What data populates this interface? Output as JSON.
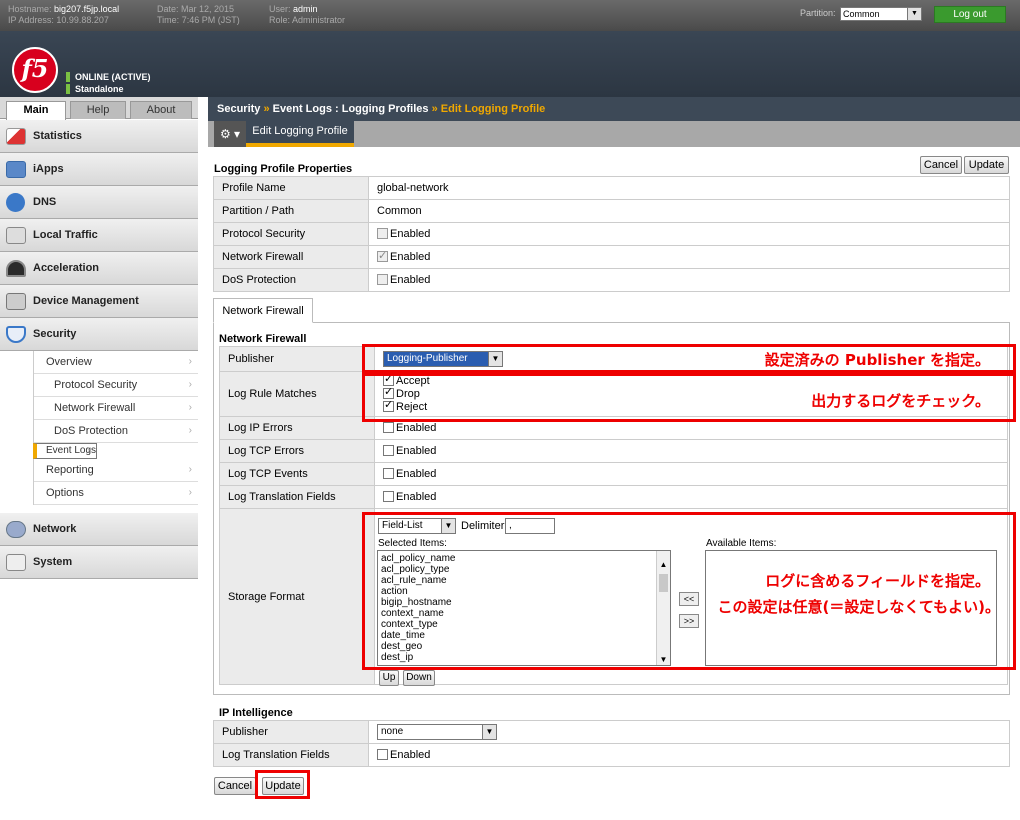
{
  "topbar": {
    "hostname_label": "Hostname:",
    "hostname": "big207.f5jp.local",
    "ip_label": "IP Address:",
    "ip": "10.99.88.207",
    "date_label": "Date:",
    "date": "Mar 12, 2015",
    "time_label": "Time:",
    "time": "7:46 PM (JST)",
    "user_label": "User:",
    "user": "admin",
    "role_label": "Role:",
    "role": "Administrator",
    "partition_label": "Partition:",
    "partition_value": "Common",
    "logout": "Log out"
  },
  "header": {
    "status1": "ONLINE (ACTIVE)",
    "status2": "Standalone",
    "logo": "f5"
  },
  "nav": {
    "tabs": [
      "Main",
      "Help",
      "About"
    ],
    "sections": [
      "Statistics",
      "iApps",
      "DNS",
      "Local Traffic",
      "Acceleration",
      "Device Management",
      "Security",
      "Network",
      "System"
    ],
    "security_items": [
      "Overview",
      "Protocol Security",
      "Network Firewall",
      "DoS Protection",
      "Event Logs",
      "Reporting",
      "Options"
    ]
  },
  "breadcrumb": {
    "part1": "Security",
    "sep1": "»",
    "part2": "Event Logs : Logging Profiles",
    "sep2": "»",
    "current": "Edit Logging Profile"
  },
  "subtab": "Edit Logging Profile",
  "buttons": {
    "cancel": "Cancel",
    "update": "Update",
    "up": "Up",
    "down": "Down",
    "move_left": "<<",
    "move_right": ">>"
  },
  "props": {
    "title": "Logging Profile Properties",
    "rows": [
      {
        "label": "Profile Name",
        "value": "global-network"
      },
      {
        "label": "Partition / Path",
        "value": "Common"
      },
      {
        "label": "Protocol Security",
        "value": "Enabled"
      },
      {
        "label": "Network Firewall",
        "value": "Enabled"
      },
      {
        "label": "DoS Protection",
        "value": "Enabled"
      }
    ]
  },
  "tab_label": "Network Firewall",
  "nf": {
    "title": "Network Firewall",
    "publisher_label": "Publisher",
    "publisher_value": "Logging-Publisher",
    "log_rule_label": "Log Rule Matches",
    "accept": "Accept",
    "drop": "Drop",
    "reject": "Reject",
    "ip_errors": "Log IP Errors",
    "tcp_errors": "Log TCP Errors",
    "tcp_events": "Log TCP Events",
    "translation": "Log Translation Fields",
    "enabled": "Enabled",
    "storage_label": "Storage Format",
    "format_value": "Field-List",
    "delimiter_label": "Delimiter",
    "delimiter_value": ",",
    "selected_label": "Selected Items:",
    "available_label": "Available Items:",
    "selected_items": [
      "acl_policy_name",
      "acl_policy_type",
      "acl_rule_name",
      "action",
      "bigip_hostname",
      "context_name",
      "context_type",
      "date_time",
      "dest_geo",
      "dest_ip"
    ]
  },
  "ipi": {
    "title": "IP Intelligence",
    "publisher_label": "Publisher",
    "publisher_value": "none",
    "translation_label": "Log Translation Fields",
    "enabled": "Enabled"
  },
  "annotations": {
    "publisher": "設定済みの Publisher を指定。",
    "logs": "出力するログをチェック。",
    "fields1": "ログに含めるフィールドを指定。",
    "fields2": "この設定は任意(＝設定しなくてもよい)。"
  }
}
